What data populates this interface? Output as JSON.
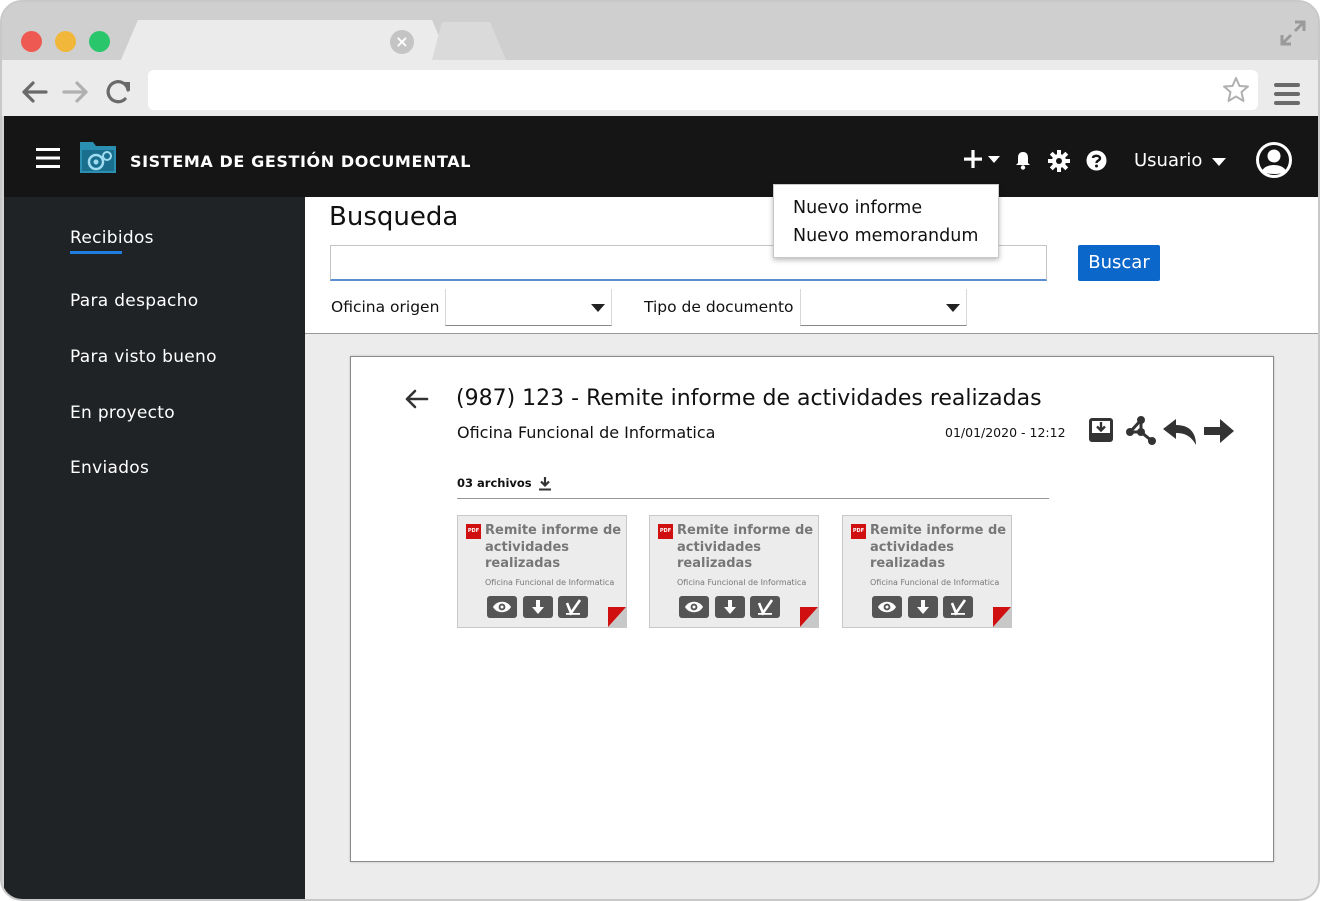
{
  "browser": {
    "tab_close": "×",
    "url": ""
  },
  "app": {
    "brand": "SISTEMA DE GESTIÓN DOCUMENTAL",
    "user_label": "Usuario"
  },
  "new_menu": {
    "items": [
      "Nuevo informe",
      "Nuevo memorandum"
    ]
  },
  "sidebar": {
    "items": [
      {
        "label": "Recibidos",
        "active": true
      },
      {
        "label": "Para despacho"
      },
      {
        "label": "Para visto bueno"
      },
      {
        "label": "En proyecto"
      },
      {
        "label": "Enviados"
      }
    ]
  },
  "search": {
    "title": "Busqueda",
    "value": "",
    "button": "Buscar",
    "filters": [
      {
        "label": "Oficina origen",
        "value": ""
      },
      {
        "label": "Tipo de documento",
        "value": ""
      }
    ]
  },
  "document": {
    "title": "(987) 123 - Remite informe de actividades realizadas",
    "office": "Oficina Funcional de Informatica",
    "datetime": "01/01/2020 - 12:12",
    "files_label": "03 archivos",
    "files": [
      {
        "badge": "PDF",
        "title": "Remite informe de actividades realizadas",
        "office": "Oficina Funcional de Informatica"
      },
      {
        "badge": "PDF",
        "title": "Remite informe de actividades realizadas",
        "office": "Oficina Funcional de Informatica"
      },
      {
        "badge": "PDF",
        "title": "Remite informe de actividades realizadas",
        "office": "Oficina Funcional de Informatica"
      }
    ]
  },
  "colors": {
    "header_bg": "#151515",
    "sidebar_bg": "#202326",
    "accent": "#0b67c9",
    "pdf_red": "#d01010"
  }
}
